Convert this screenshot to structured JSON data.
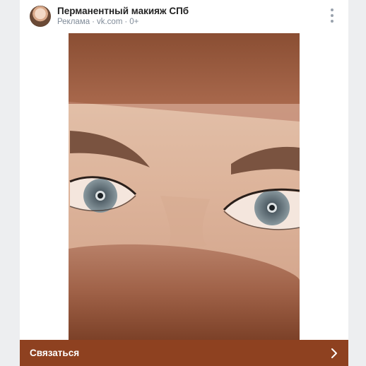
{
  "post": {
    "author": "Перманентный макияж СПб",
    "meta_sponsored": "Реклама",
    "meta_domain": "vk.com",
    "meta_age": "0+",
    "separator": "·"
  },
  "media": {
    "description_icon": "ad-image"
  },
  "cta": {
    "label": "Связаться"
  },
  "icons": {
    "more": "more-vertical-icon",
    "chevron": "chevron-right-icon"
  },
  "colors": {
    "cta_background": "#8e4120",
    "meta_text": "#818c99"
  }
}
